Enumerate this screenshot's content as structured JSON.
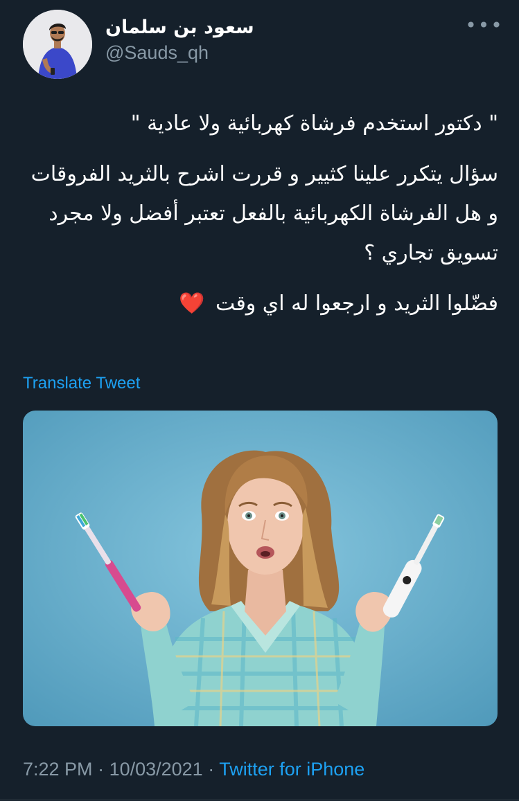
{
  "author": {
    "display_name": "سعود بن سلمان",
    "handle": "@Sauds_qh"
  },
  "more_icon": "ellipsis-icon",
  "tweet": {
    "paragraphs": [
      "\" دكتور استخدم فرشاة كهربائية ولا عادية \"",
      "سؤال يتكرر علينا كثيير و قررت اشرح بالثريد الفروقات و هل الفرشاة الكهربائية بالفعل تعتبر أفضل ولا مجرد تسويق تجاري ؟",
      "فضّلوا الثريد و ارجعوا له اي وقت"
    ],
    "emoji": "❤️"
  },
  "translate_label": "Translate Tweet",
  "media": {
    "description_icon": "photo-woman-toothbrushes"
  },
  "meta": {
    "time": "7:22 PM",
    "separator": " · ",
    "date": "10/03/2021",
    "source": "Twitter for iPhone"
  },
  "colors": {
    "background": "#15202b",
    "text": "#ffffff",
    "muted": "#8899a6",
    "accent": "#1da1f2",
    "heart": "#e0245e"
  }
}
